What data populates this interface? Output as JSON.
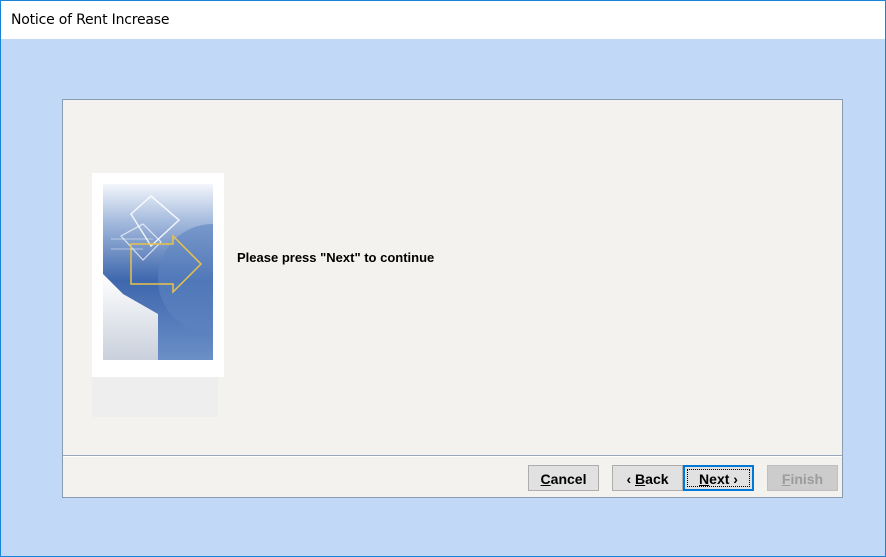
{
  "window": {
    "title": "Notice of Rent Increase"
  },
  "wizard": {
    "message": "Please press \"Next\" to continue",
    "image_icon": "wizard-graphic"
  },
  "buttons": {
    "cancel": {
      "mnemonic": "C",
      "rest": "ancel",
      "enabled": true
    },
    "back": {
      "prefix": "‹ ",
      "mnemonic": "B",
      "rest": "ack",
      "enabled": true
    },
    "next": {
      "mnemonic": "N",
      "rest": "ext ›",
      "enabled": true,
      "focused": true
    },
    "finish": {
      "mnemonic": "F",
      "rest": "inish",
      "enabled": false
    }
  },
  "colors": {
    "background": "#c2d8f7",
    "dialog": "#f3f2ee",
    "accent": "#0078d7"
  }
}
